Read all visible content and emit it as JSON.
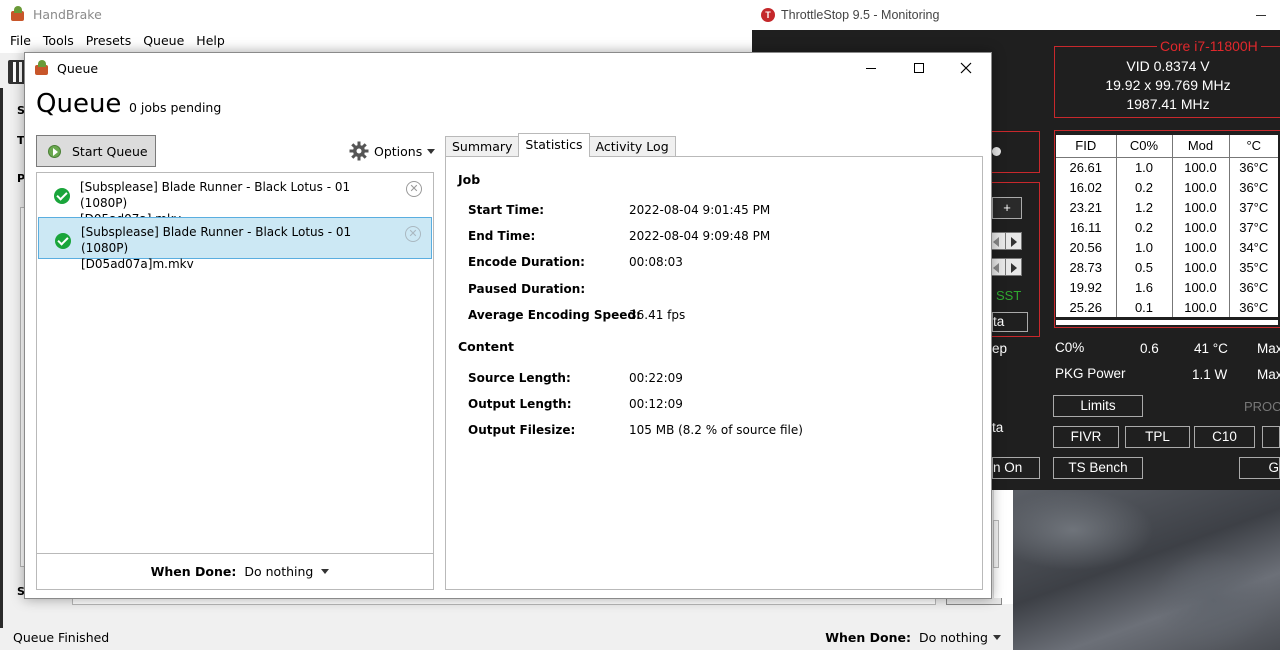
{
  "handbrake": {
    "title": "HandBrake",
    "menu": [
      "File",
      "Tools",
      "Presets",
      "Queue",
      "Help"
    ],
    "side_letters": [
      "S",
      "T",
      "P",
      "S"
    ],
    "status_text": "Queue Finished",
    "when_done_label": "When Done:",
    "when_done_value": "Do nothing"
  },
  "queue_window": {
    "title": "Queue",
    "heading": "Queue",
    "pending": "0 jobs pending",
    "start_button": "Start Queue",
    "options_label": "Options",
    "items": [
      {
        "line1": "[Subsplease] Blade Runner - Black Lotus - 01 (1080P)",
        "line2": "[D05ad07a].mkv",
        "selected": false
      },
      {
        "line1": "[Subsplease] Blade Runner - Black Lotus - 01 (1080P)",
        "line2": "[D05ad07a]m.mkv",
        "selected": true
      }
    ],
    "when_done_label": "When Done:",
    "when_done_value": "Do nothing",
    "tabs": [
      {
        "label": "Summary",
        "active": false
      },
      {
        "label": "Statistics",
        "active": true
      },
      {
        "label": "Activity Log",
        "active": false
      }
    ],
    "statistics": {
      "job_title": "Job",
      "start_time_label": "Start Time:",
      "start_time": "2022-08-04 9:01:45 PM",
      "end_time_label": "End Time:",
      "end_time": "2022-08-04 9:09:48 PM",
      "encode_duration_label": "Encode Duration:",
      "encode_duration": "00:08:03",
      "paused_duration_label": "Paused Duration:",
      "paused_duration": "",
      "avg_speed_label": "Average Encoding Speed:",
      "avg_speed": "36.41 fps",
      "content_title": "Content",
      "source_length_label": "Source Length:",
      "source_length": "00:22:09",
      "output_length_label": "Output Length:",
      "output_length": "00:12:09",
      "output_filesize_label": "Output Filesize:",
      "output_filesize": "105 MB (8.2 % of source file)"
    }
  },
  "throttlestop": {
    "title": "ThrottleStop 9.5 - Monitoring",
    "logo_letter": "T",
    "cpu_name": "Core i7-11800H",
    "vid": "VID  0.8374 V",
    "multiplier": "19.92 x 99.769 MHz",
    "frequency": "1987.41 MHz",
    "left_labels": {
      "plus": "+",
      "sst": "SST",
      "ta1": "ta",
      "ep": "ep",
      "ta2": "ta",
      "on": "n On"
    },
    "table_headers": [
      "FID",
      "C0%",
      "Mod",
      "°C"
    ],
    "table_rows": [
      [
        "26.61",
        "1.0",
        "100.0",
        "36°C"
      ],
      [
        "16.02",
        "0.2",
        "100.0",
        "36°C"
      ],
      [
        "23.21",
        "1.2",
        "100.0",
        "37°C"
      ],
      [
        "16.11",
        "0.2",
        "100.0",
        "37°C"
      ],
      [
        "20.56",
        "1.0",
        "100.0",
        "34°C"
      ],
      [
        "28.73",
        "0.5",
        "100.0",
        "35°C"
      ],
      [
        "19.92",
        "1.6",
        "100.0",
        "36°C"
      ],
      [
        "25.26",
        "0.1",
        "100.0",
        "36°C"
      ]
    ],
    "c0_label": "C0%",
    "c0_value": "0.6",
    "temp_value": "41 °C",
    "max1": "Max",
    "pkg_label": "PKG Power",
    "pkg_value": "1.1 W",
    "max2": "Max",
    "buttons": {
      "limits": "Limits",
      "fivr": "FIVR",
      "tpl": "TPL",
      "c10": "C10",
      "ts_bench": "TS Bench",
      "g": "G"
    },
    "proc_label": "PROC"
  },
  "colors": {
    "accent_red": "#c8282c",
    "selection": "#cce8f4",
    "check_green": "#1aa53b"
  }
}
